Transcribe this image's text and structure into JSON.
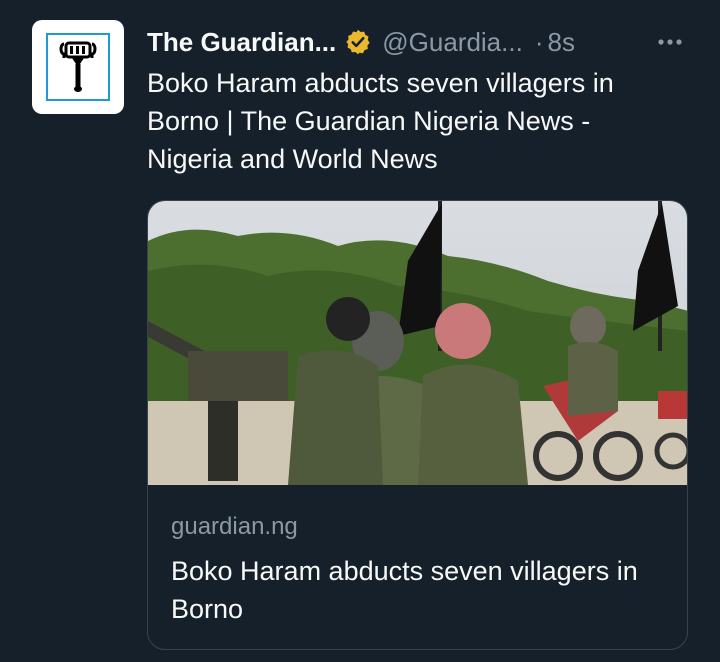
{
  "tweet": {
    "display_name": "The Guardian...",
    "handle": "@Guardia...",
    "separator": "·",
    "time": "8s",
    "more_symbol": "•••",
    "text": "Boko Haram abducts seven villagers in Borno | The Guardian Nigeria News - Nigeria and World News",
    "verified_color": "#e9b82e",
    "avatar_icon": "guardian-logo-icon"
  },
  "card": {
    "domain": "guardian.ng",
    "title": "Boko Haram abducts seven villagers in Borno",
    "image_icon": "news-photo-icon"
  }
}
